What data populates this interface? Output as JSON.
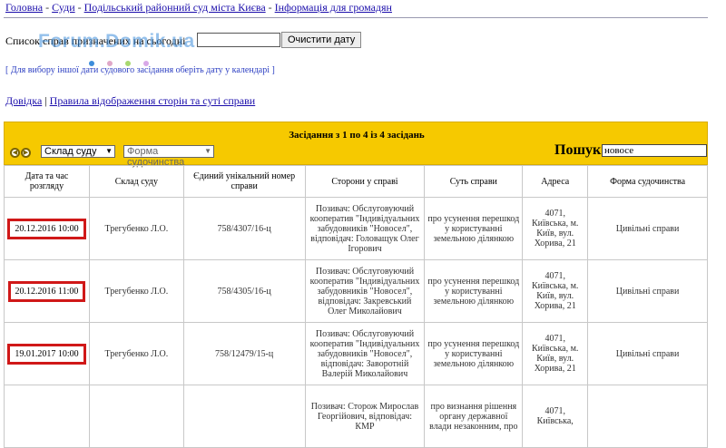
{
  "breadcrumb": {
    "home": "Головна",
    "courts": "Суди",
    "court": "Подільський районний суд міста Києва",
    "info": "Інформація для громадян",
    "sep": " - "
  },
  "list_label": "Список справ призначених на сьогодні",
  "date_input": {
    "value": ""
  },
  "clear_button": "Очистити дату",
  "watermark": "Forum.Domik.ua",
  "hint": "[ Для вибору іншої дати судового засідання оберіть дату у календарі ]",
  "links": {
    "help": "Довідка",
    "sep": " | ",
    "rules": "Правила відображення сторін та суті справи"
  },
  "sessions_title": "Засідання з 1 по 4 із 4 засідань",
  "filters": {
    "composition": "Склад суду",
    "form": "Форма судочинства"
  },
  "search": {
    "label": "Пошук:",
    "value": "новосе"
  },
  "columns": [
    "Дата та час розгляду",
    "Склад суду",
    "Єдиний унікальний номер справи",
    "Сторони у справі",
    "Суть справи",
    "Адреса",
    "Форма судочинства"
  ],
  "rows": [
    {
      "date": "20.12.2016 10:00",
      "judge": "Трегубенко Л.О.",
      "number": "758/4307/16-ц",
      "parties": "Позивач: Обслуговуючий кооператив \"Індивідуальних забудовників \"Новосел\", відповідач: Головащук Олег Ігорович",
      "essence": "про усунення перешкод у користуванні земельною ділянкою",
      "address": "4071, Київська, м. Київ, вул. Хорива, 21",
      "form": "Цивільні справи"
    },
    {
      "date": "20.12.2016 11:00",
      "judge": "Трегубенко Л.О.",
      "number": "758/4305/16-ц",
      "parties": "Позивач: Обслуговуючий кооператив \"Індивідуальних забудовників \"Новосел\", відповідач: Закревський Олег Миколайович",
      "essence": "про усунення перешкод у користуванні земельною ділянкою",
      "address": "4071, Київська, м. Київ, вул. Хорива, 21",
      "form": "Цивільні справи"
    },
    {
      "date": "19.01.2017 10:00",
      "judge": "Трегубенко Л.О.",
      "number": "758/12479/15-ц",
      "parties": "Позивач: Обслуговуючий кооператив \"Індивідуальних забудовників \"Новосел\", відповідач: Заворотній Валерій Миколайович",
      "essence": "про усунення перешкод у користуванні земельною ділянкою",
      "address": "4071, Київська, м. Київ, вул. Хорива, 21",
      "form": "Цивільні справи"
    },
    {
      "date": "",
      "judge": "",
      "number": "",
      "parties": "Позивач: Сторож Мирослав Георгійович, відповідач: КМР",
      "essence": "про визнання рішення органу державної влади незаконним, про",
      "address": "4071, Київська,",
      "form": ""
    }
  ],
  "colors": {
    "header_band": "#f6c900",
    "date_highlight": "#d01818",
    "link": "#1a0dab"
  }
}
